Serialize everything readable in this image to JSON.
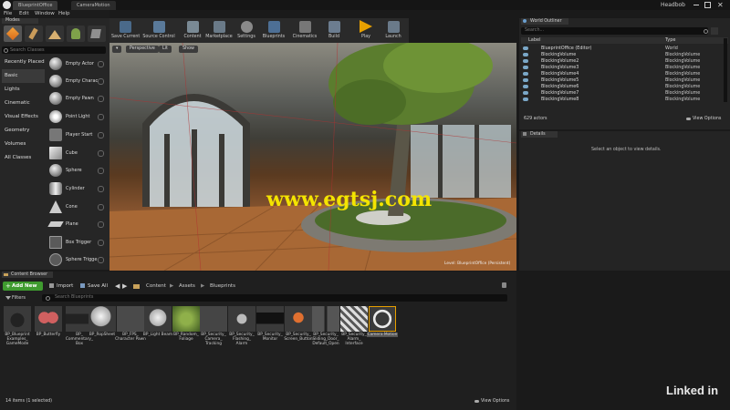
{
  "window": {
    "tabs": [
      "BlueprintOffice",
      "CameraMotion"
    ],
    "project": "Headbob"
  },
  "menu": [
    "File",
    "Edit",
    "Window",
    "Help"
  ],
  "modes": {
    "title": "Modes",
    "search_placeholder": "Search Classes",
    "categories": [
      "Recently Placed",
      "Basic",
      "Lights",
      "Cinematic",
      "Visual Effects",
      "Geometry",
      "Volumes",
      "All Classes"
    ],
    "items": [
      "Empty Actor",
      "Empty Charac",
      "Empty Pawn",
      "Point Light",
      "Player Start",
      "Cube",
      "Sphere",
      "Cylinder",
      "Cone",
      "Plane",
      "Box Trigger",
      "Sphere Trigge"
    ]
  },
  "toolbar": [
    "Save Current",
    "Source Control",
    "Content",
    "Marketplace",
    "Settings",
    "Blueprints",
    "Cinematics",
    "Build",
    "Play",
    "Launch"
  ],
  "viewport": {
    "buttons": [
      "Perspective",
      "Lit",
      "Show"
    ],
    "level_label": "Level: BlueprintOffice (Persistent)",
    "watermark": "www.egtsj.com"
  },
  "outliner": {
    "title": "World Outliner",
    "search_placeholder": "Search...",
    "col_label": "Label",
    "col_type": "Type",
    "rows": [
      {
        "label": "BlueprintOffice (Editor)",
        "type": "World"
      },
      {
        "label": "BlockingVolume",
        "type": "BlockingVolume"
      },
      {
        "label": "BlockingVolume2",
        "type": "BlockingVolume"
      },
      {
        "label": "BlockingVolume3",
        "type": "BlockingVolume"
      },
      {
        "label": "BlockingVolume4",
        "type": "BlockingVolume"
      },
      {
        "label": "BlockingVolume5",
        "type": "BlockingVolume"
      },
      {
        "label": "BlockingVolume6",
        "type": "BlockingVolume"
      },
      {
        "label": "BlockingVolume7",
        "type": "BlockingVolume"
      },
      {
        "label": "BlockingVolume8",
        "type": "BlockingVolume"
      }
    ],
    "count": "629 actors",
    "view_options": "View Options"
  },
  "details": {
    "title": "Details",
    "empty_msg": "Select an object to view details."
  },
  "browser": {
    "title": "Content Browser",
    "add_new": "Add New",
    "import": "Import",
    "save_all": "Save All",
    "path": [
      "Content",
      "Assets",
      "Blueprints"
    ],
    "filters": "Filters",
    "search_placeholder": "Search Blueprints",
    "items": [
      "BP_Blueprint Examples_ GameMode",
      "BP_Butterfly",
      "BP_ Commentary_ Box",
      "BP_RopSheet",
      "BP_FPS_ Character Pawn",
      "BP_Light Beam",
      "BP_Random_ Foliage",
      "BP_Security_ Camera_ Tracking",
      "BP_Security_ Flashing_ Alarm",
      "BP_Security_ Monitor",
      "BP_Security_ Screen_Button",
      "BP_Security_ Sliding_Door_ Default_Open",
      "BP_Security_ Alarm_ Interface",
      "Camera Motion"
    ],
    "status": "14 items (1 selected)",
    "view_options": "View Options"
  },
  "branding": "Linked in",
  "colors": {
    "add_new": "#3f9b2f",
    "selected": "#e8a000",
    "play": "#e8a000"
  }
}
